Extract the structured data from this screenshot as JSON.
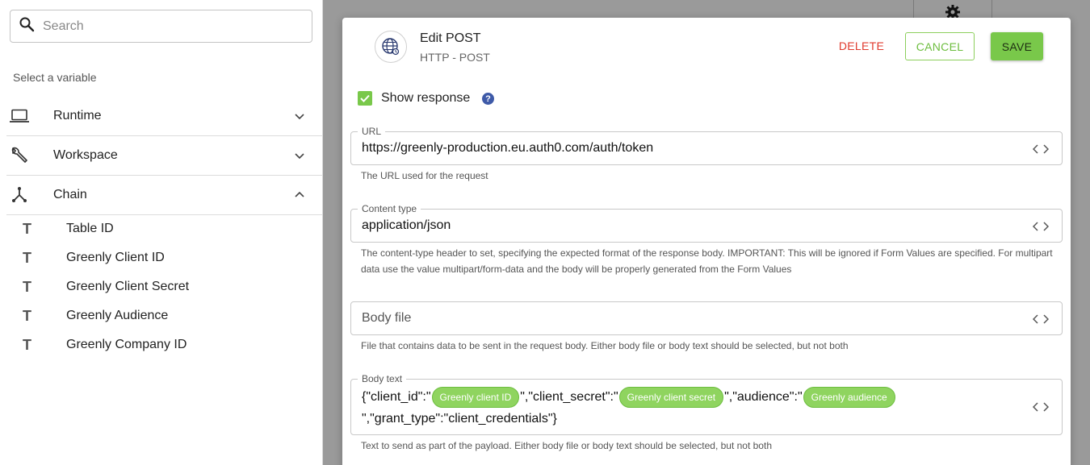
{
  "sidebar": {
    "search_placeholder": "Search",
    "select_label": "Select a variable",
    "groups": [
      {
        "label": "Runtime",
        "icon": "laptop-icon",
        "expanded": false
      },
      {
        "label": "Workspace",
        "icon": "wrench-icon",
        "expanded": false
      },
      {
        "label": "Chain",
        "icon": "chain-icon",
        "expanded": true
      }
    ],
    "variables": [
      {
        "type_glyph": "T",
        "label": "Table ID"
      },
      {
        "type_glyph": "T",
        "label": "Greenly Client ID"
      },
      {
        "type_glyph": "T",
        "label": "Greenly Client Secret"
      },
      {
        "type_glyph": "T",
        "label": "Greenly Audience"
      },
      {
        "type_glyph": "T",
        "label": "Greenly Company ID"
      }
    ]
  },
  "dialog": {
    "icon": "globe-icon",
    "title": "Edit POST",
    "subtitle": "HTTP - POST",
    "delete_label": "DELETE",
    "cancel_label": "CANCEL",
    "save_label": "SAVE",
    "show_response_label": "Show response",
    "show_response_checked": true,
    "help_glyph": "?",
    "url": {
      "label": "URL",
      "value": "https://greenly-production.eu.auth0.com/auth/token",
      "helper": "The URL used for the request"
    },
    "content_type": {
      "label": "Content type",
      "value": "application/json",
      "helper_line1": "The content-type header to set, specifying the expected format of the response body. IMPORTANT: This will be ignored if Form Values are specified. For multipart",
      "helper_line2": "data use the value multipart/form-data and the body will be properly generated from the Form Values"
    },
    "body_file": {
      "placeholder": "Body file",
      "helper": "File that contains data to be sent in the request body. Either body file or body text should be selected, but not both"
    },
    "body_text": {
      "label": "Body text",
      "seg1": "{\"client_id\":\"",
      "chip1": "Greenly client ID",
      "seg2": "\",\"client_secret\":\"",
      "chip2": "Greenly client secret",
      "seg3": "\",\"audience\":\"",
      "chip3": "Greenly audience",
      "seg4": "\",\"grant_type\":\"client_credentials\"}",
      "helper": "Text to send as part of the payload. Either body file or body text should be selected, but not both"
    }
  },
  "colors": {
    "accent_green": "#79c84a",
    "delete_red": "#e03b2e",
    "help_blue": "#3e5aa8"
  }
}
